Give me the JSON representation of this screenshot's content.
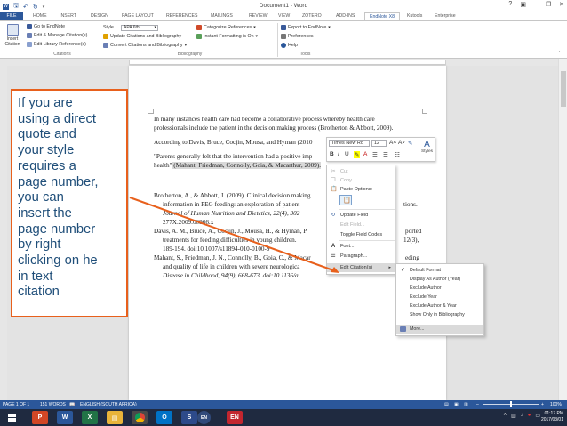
{
  "window": {
    "title": "Document1 - Word",
    "help": "?"
  },
  "tabs": {
    "file": "FILE",
    "home": "HOME",
    "insert": "INSERT",
    "design": "DESIGN",
    "page_layout": "PAGE LAYOUT",
    "references": "REFERENCES",
    "mailings": "MAILINGS",
    "review": "REVIEW",
    "view": "VIEW",
    "zotero": "ZOTERO",
    "addins": "ADD-INS",
    "endnote": "EndNote X8",
    "kutools": "Kutools",
    "enterprise": "Enterprise"
  },
  "ribbon": {
    "insert_citation": "Insert\nCitation",
    "go_to_endnote": "Go to EndNote",
    "edit_manage": "Edit & Manage Citation(s)",
    "edit_library": "Edit Library Reference(s)",
    "style_label": "Style",
    "style_value": "APA 6th",
    "update_citations": "Update Citations and Bibliography",
    "convert_citations": "Convert Citations and Bibliography",
    "categorize": "Categorize References",
    "instant_formatting": "Instant Formatting is On",
    "export": "Export to EndNote",
    "preferences": "Preferences",
    "help": "Help",
    "group_citations": "Citations",
    "group_bibliography": "Bibliography",
    "group_tools": "Tools"
  },
  "document": {
    "para1_line1": "In many instances health care had become a collaborative process whereby health care",
    "para1_line2": "professionals include the patient in the decision making process (Brotherton & Abbott, 2009).",
    "para2": "According to Davis, Bruce, Cocjin, Mousa, and Hyman (2010",
    "para3_line1": "\"Parents generally felt that the intervention had a positive imp",
    "para3_line2_a": "health\"",
    "para3_line2_b": " (Mahant, Friedman, Connolly, Goia, & Macarthur, 2009).",
    "ref1_line1": "Brotherton, A., & Abbott, J. (2009). Clinical decision making",
    "ref1_line2": "information in PEG feeding: an exploration of patient",
    "ref1_line2_end": "tions.",
    "ref1_line3": "Journal of Human Nutrition and Dietetics, 22(4), 302",
    "ref1_line4": "277X.2009.00966.x",
    "ref2_line1": "Davis, A. M., Bruce, A., Cocjin, J., Mousa, H., & Hyman, P.",
    "ref2_line1_end": "ported",
    "ref2_line2": "treatments for feeding difficulties in young children.",
    "ref2_line2_end": "12(3),",
    "ref2_line3": "189-194. doi:10.1007/s11894-010-0100-9",
    "ref3_line1": "Mahant, S., Friedman, J. N., Connolly, B., Goia, C., & Macar",
    "ref3_line1_end": "eding",
    "ref3_line2": "and quality of life in children with severe neurologica",
    "ref3_line3": "Disease in Childhood, 94(9), 668-673. doi:10.1136/a"
  },
  "mini_toolbar": {
    "font": "Times New Ro",
    "size": "12",
    "styles": "Styles"
  },
  "context_menu": {
    "cut": "Cut",
    "copy": "Copy",
    "paste_options": "Paste Options:",
    "update_field": "Update Field",
    "edit_field": "Edit Field...",
    "toggle_field_codes": "Toggle Field Codes",
    "font": "Font...",
    "paragraph": "Paragraph...",
    "edit_citations": "Edit Citation(s)"
  },
  "submenu": {
    "default_format": "Default Format",
    "display_as_author": "Display As Author (Year)",
    "exclude_author": "Exclude Author",
    "exclude_year": "Exclude Year",
    "exclude_author_year": "Exclude Author & Year",
    "show_only_bibliography": "Show Only in Bibliography",
    "more": "More..."
  },
  "callout": {
    "text": "If you are\nusing a direct\nquote and\nyour style\nrequires a\npage number,\nyou can\ninsert the\npage number\nby right\nclicking on he\nin text\ncitation"
  },
  "status_bar": {
    "page": "PAGE 1 OF 1",
    "words": "151 WORDS",
    "language": "ENGLISH (SOUTH AFRICA)",
    "zoom": "100%"
  },
  "taskbar": {
    "en": "EN",
    "time": "01:17 PM",
    "date": "2017/03/01"
  },
  "colors": {
    "word_blue": "#2b579a",
    "callout_border": "#e8601c",
    "callout_text": "#1f4e79"
  }
}
